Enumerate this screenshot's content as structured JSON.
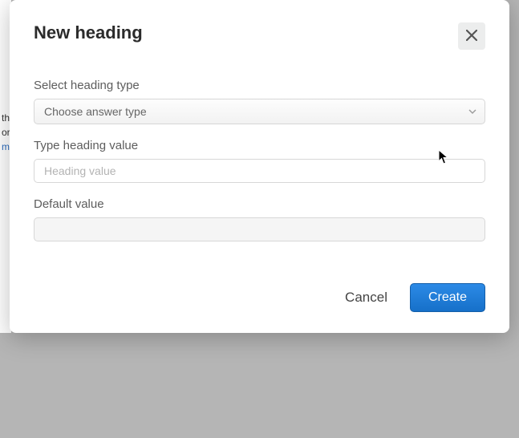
{
  "modal": {
    "title": "New heading",
    "fields": {
      "heading_type": {
        "label": "Select heading type",
        "selected": "Choose answer type"
      },
      "heading_value": {
        "label": "Type heading value",
        "placeholder": "Heading value",
        "value": ""
      },
      "default_value": {
        "label": "Default value",
        "value": ""
      }
    },
    "actions": {
      "cancel": "Cancel",
      "create": "Create"
    }
  },
  "backdrop_fragments": {
    "l1": "th",
    "l2": "or",
    "l3": "m"
  }
}
